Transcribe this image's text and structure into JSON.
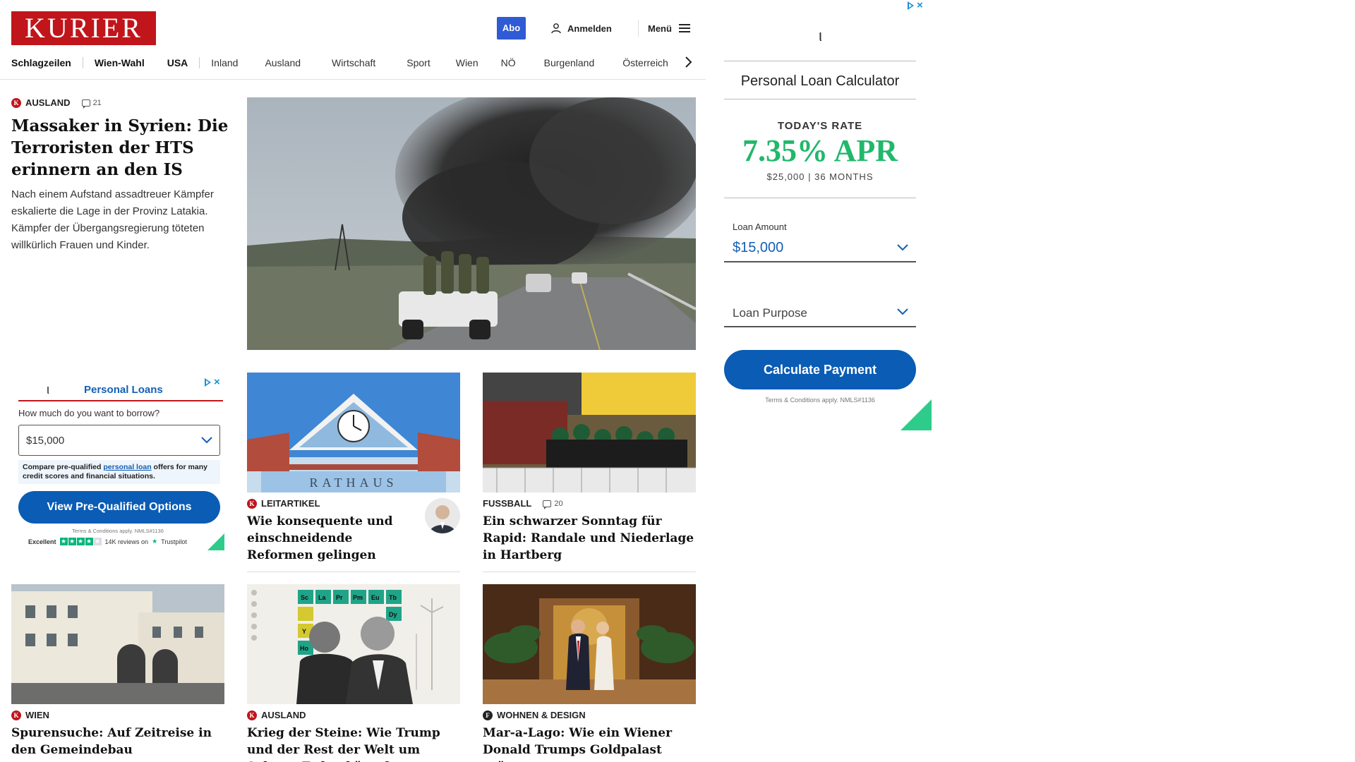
{
  "header": {
    "logo": "KURIER",
    "abo": "Abo",
    "login": "Anmelden",
    "menu": "Menü"
  },
  "nav": {
    "items": [
      "Schlagzeilen",
      "Wien-Wahl",
      "USA",
      "Inland",
      "Ausland",
      "Wirtschaft",
      "Sport",
      "Wien",
      "NÖ",
      "Burgenland",
      "Österreich"
    ]
  },
  "lead": {
    "kicker": "AUSLAND",
    "comments": "21",
    "title": "Massaker in Syrien: Die Terroristen der HTS erinnern an den IS",
    "teaser": "Nach einem Aufstand assadtreuer Kämpfer eskalierte die Lage in der Provinz Latakia. Kämpfer der Übergangsregierung töteten willkürlich Frauen und Kinder."
  },
  "cards": [
    {
      "kicker": "LEITARTIKEL",
      "comments": "",
      "title": "Wie konsequente und einschneidende Reformen gelingen",
      "image_text": "RATHAUS"
    },
    {
      "kicker": "FUSSBALL",
      "comments": "20",
      "title": "Ein schwarzer Sonntag für Rapid: Randale und Niederlage in Hartberg"
    },
    {
      "kicker": "WIEN",
      "comments": "",
      "title": "Spurensuche: Auf Zeitreise in den Gemeindebau"
    },
    {
      "kicker": "AUSLAND",
      "comments": "",
      "title": "Krieg der Steine: Wie Trump und der Rest der Welt um Seltene Erden kämpfen",
      "image_text": [
        "Sc",
        "La",
        "Pr",
        "Pm",
        "Eu",
        "Tb",
        "Y",
        "Dy",
        "Ho"
      ]
    },
    {
      "kicker": "WOHNEN & DESIGN",
      "comments": "",
      "title": "Mar-a-Lago: Wie ein Wiener Donald Trumps Goldpalast prägte"
    }
  ],
  "ad_small": {
    "brand": "ι",
    "headline": "Personal Loans",
    "question": "How much do you want to borrow?",
    "amount": "$15,000",
    "note_pre": "Compare pre-qualified ",
    "note_link": "personal loan",
    "note_post": " offers for many credit scores and financial situations.",
    "button": "View Pre-Qualified Options",
    "terms": "Terms & Conditions apply. NMLS#1136",
    "tp_rating": "Excellent",
    "tp_reviews": "14K reviews on",
    "tp_brand": "Trustpilot",
    "tp_stars": 4.5
  },
  "ad_big": {
    "brand": "ι",
    "title": "Personal Loan Calculator",
    "rate_label": "TODAY'S RATE",
    "rate": "7.35% APR",
    "rate_sub": "$25,000 | 36 MONTHS",
    "amount_label": "Loan Amount",
    "amount": "$15,000",
    "purpose": "Loan Purpose",
    "button": "Calculate Payment",
    "terms": "Terms & Conditions apply. NMLS#1136"
  },
  "colors": {
    "brand_red": "#c0151b",
    "abo_blue": "#2f5bd4",
    "ad_blue": "#0a5cb5",
    "rate_green": "#21b86b"
  }
}
